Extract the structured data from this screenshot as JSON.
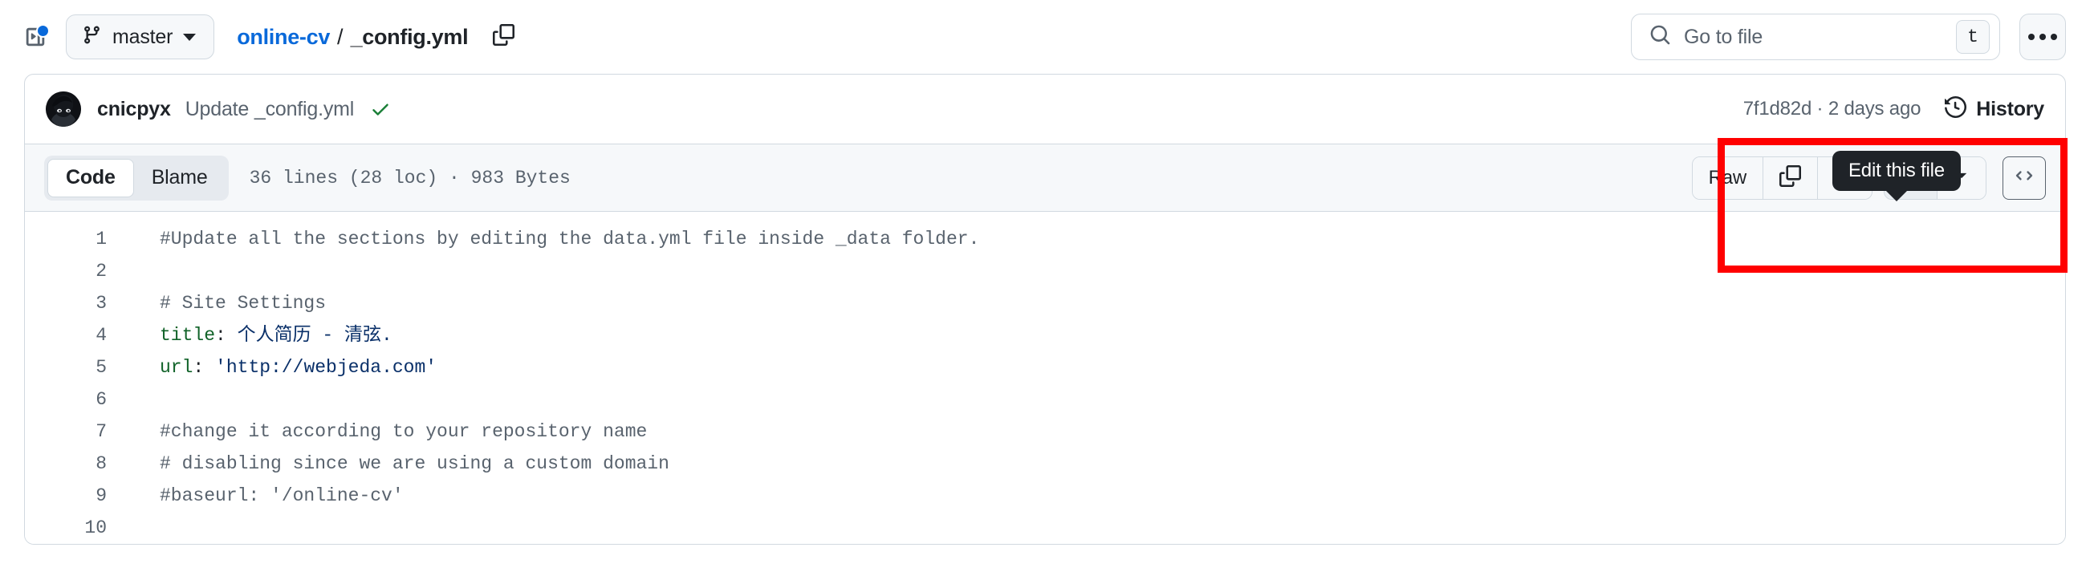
{
  "header": {
    "sidebar_toggle_icon": "sidebar-expand-icon",
    "has_notification_dot": true,
    "branch": {
      "icon": "git-branch-icon",
      "name": "master"
    },
    "breadcrumb": {
      "repo": "online-cv",
      "separator": "/",
      "file": "_config.yml",
      "copy_icon": "copy-path-icon"
    },
    "search": {
      "icon": "search-icon",
      "placeholder": "Go to file",
      "shortcut": "t"
    },
    "more_menu_icon": "kebab-horizontal-icon"
  },
  "commit": {
    "avatar_alt": "cnicpyx",
    "author": "cnicpyx",
    "message": "Update _config.yml",
    "status_icon": "check-icon",
    "sha": "7f1d82d",
    "dot": "·",
    "relative_time": "2 days ago",
    "history_icon": "history-clock-icon",
    "history_label": "History"
  },
  "file_toolbar": {
    "tabs": [
      {
        "label": "Code",
        "active": true
      },
      {
        "label": "Blame",
        "active": false
      }
    ],
    "file_meta": "36 lines (28 loc) · 983 Bytes",
    "actions": {
      "raw_label": "Raw",
      "copy_icon": "copy-raw-content-icon",
      "download_icon": "download-raw-file-icon",
      "edit_icon": "pencil-edit-icon",
      "edit_caret_icon": "chevron-down-icon",
      "symbols_icon": "code-symbols-icon"
    }
  },
  "tooltip": {
    "text": "Edit this file",
    "target": "pencil-edit-icon"
  },
  "annotation": {
    "color": "#ff0000",
    "shape": "rectangle",
    "highlights": "file-action-toolbar"
  },
  "code": {
    "lines": [
      {
        "n": "1",
        "tokens": [
          {
            "t": "comment",
            "v": "#Update all the sections by editing the data.yml file inside _data folder."
          }
        ]
      },
      {
        "n": "2",
        "tokens": []
      },
      {
        "n": "3",
        "tokens": [
          {
            "t": "comment",
            "v": "# Site Settings"
          }
        ]
      },
      {
        "n": "4",
        "tokens": [
          {
            "t": "keyname",
            "v": "title"
          },
          {
            "t": "plain",
            "v": ": "
          },
          {
            "t": "str",
            "v": "个人简历 - 清弦."
          }
        ]
      },
      {
        "n": "5",
        "tokens": [
          {
            "t": "keyname",
            "v": "url"
          },
          {
            "t": "plain",
            "v": ": "
          },
          {
            "t": "str",
            "v": "'http://webjeda.com'"
          }
        ]
      },
      {
        "n": "6",
        "tokens": []
      },
      {
        "n": "7",
        "tokens": [
          {
            "t": "comment",
            "v": "#change it according to your repository name"
          }
        ]
      },
      {
        "n": "8",
        "tokens": [
          {
            "t": "comment",
            "v": "# disabling since we are using a custom domain"
          }
        ]
      },
      {
        "n": "9",
        "tokens": [
          {
            "t": "comment",
            "v": "#baseurl: '/online-cv'"
          }
        ]
      },
      {
        "n": "10",
        "tokens": []
      }
    ]
  },
  "colors": {
    "link": "#0969da",
    "text": "#1f2328",
    "muted": "#59636e",
    "border": "#d1d9e0",
    "surface": "#f6f8fa",
    "success": "#1a7f37",
    "annotation": "#ff0000",
    "yaml_key": "#116329",
    "yaml_value": "#0a3069"
  }
}
